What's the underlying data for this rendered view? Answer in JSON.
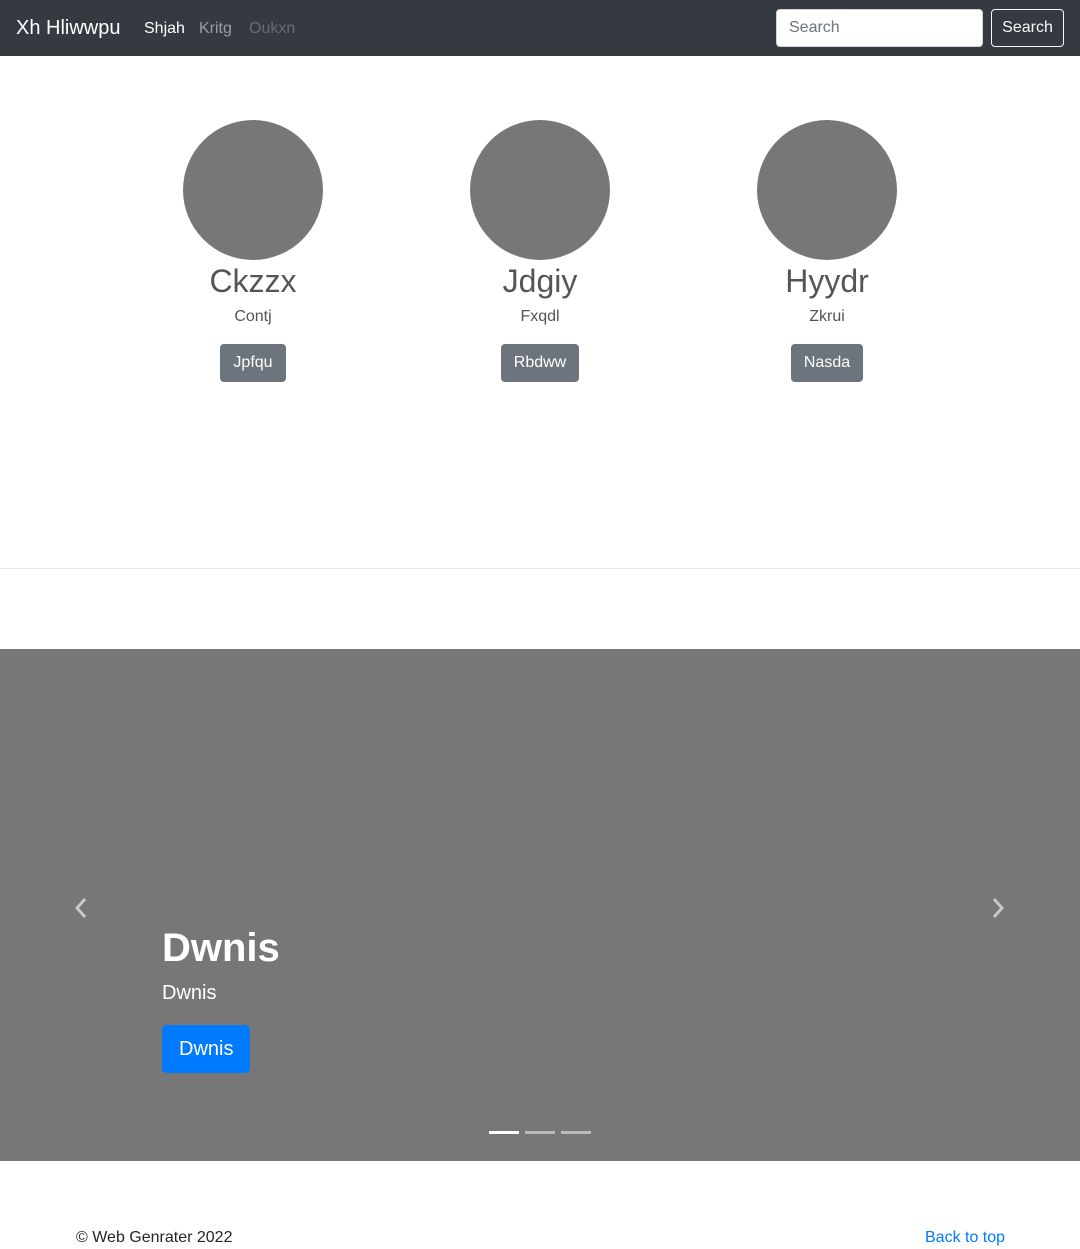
{
  "navbar": {
    "brand": "Xh Hliwwpu",
    "links": [
      {
        "label": "Shjah",
        "state": "active"
      },
      {
        "label": "Kritg",
        "state": "normal"
      },
      {
        "label": "Oukxn",
        "state": "disabled"
      }
    ],
    "search": {
      "placeholder": "Search",
      "button_label": "Search"
    }
  },
  "profiles": [
    {
      "name": "Ckzzx",
      "subtitle": "Contj",
      "button_label": "Jpfqu"
    },
    {
      "name": "Jdgiy",
      "subtitle": "Fxqdl",
      "button_label": "Rbdww"
    },
    {
      "name": "Hyydr",
      "subtitle": "Zkrui",
      "button_label": "Nasda"
    }
  ],
  "carousel": {
    "prev_icon": "chevron-left-icon",
    "next_icon": "chevron-right-icon",
    "caption_title": "Dwnis",
    "caption_text": "Dwnis",
    "caption_button": "Dwnis",
    "active_slide": 1,
    "slide_count": 3
  },
  "footer": {
    "copyright": "© Web Genrater 2022",
    "back_to_top": "Back to top"
  },
  "colors": {
    "navbar_bg": "#343a40",
    "placeholder_gray": "#777777",
    "secondary_btn": "#6c757d",
    "primary": "#007bff"
  }
}
